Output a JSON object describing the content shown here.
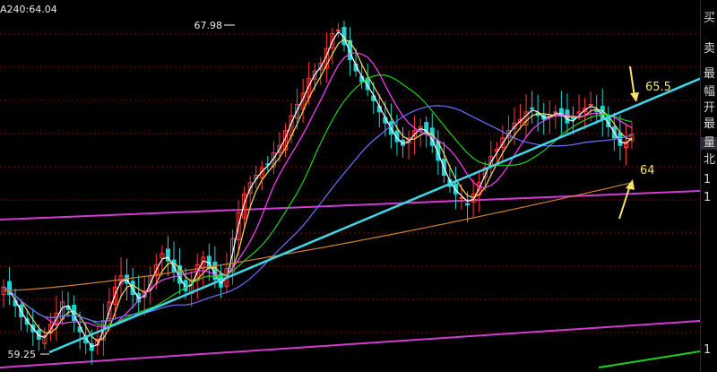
{
  "ma_label": "A240:64.04",
  "sidebar": {
    "items": [
      "买",
      "卖",
      "最",
      "幅",
      "开",
      "最",
      "量",
      "北",
      "1",
      "1",
      "1"
    ]
  },
  "colors": {
    "background": "#000000",
    "up_candle": "#ff3b3b",
    "down_candle": "#22d3d3",
    "grid": "#8b0000",
    "ma_fast": "#ffffff",
    "ma_5": "#f0e060",
    "ma_10": "#ff40ff",
    "ma_20": "#1fd01f",
    "ma_60": "#7070ff",
    "ma_240": "#d08030",
    "trendline": "#3fd7e8",
    "channel": "#d23cd2",
    "annotation": "#f4e46a"
  },
  "chart_data": {
    "type": "candlestick",
    "ylim": [
      59.25,
      67.98
    ],
    "high_label": "67.98",
    "low_label": "59.25",
    "closes": [
      61.0,
      60.8,
      60.5,
      60.2,
      60.0,
      59.8,
      59.6,
      59.7,
      60.0,
      60.3,
      60.6,
      60.4,
      60.1,
      59.8,
      59.5,
      59.3,
      59.6,
      60.1,
      60.6,
      61.0,
      61.3,
      61.1,
      60.8,
      60.6,
      60.9,
      61.3,
      61.6,
      61.9,
      61.7,
      61.4,
      61.1,
      60.9,
      61.2,
      61.6,
      61.8,
      61.5,
      61.2,
      61.0,
      61.5,
      62.3,
      63.0,
      63.5,
      63.8,
      64.0,
      64.2,
      64.3,
      64.6,
      64.8,
      65.2,
      65.6,
      65.9,
      66.2,
      66.6,
      66.8,
      67.0,
      67.4,
      67.8,
      67.9,
      67.5,
      67.1,
      66.8,
      66.5,
      66.3,
      66.0,
      65.7,
      65.4,
      65.1,
      64.9,
      64.8,
      65.0,
      65.2,
      65.3,
      65.1,
      64.8,
      64.4,
      64.0,
      63.7,
      63.5,
      63.4,
      63.2,
      63.5,
      63.8,
      64.2,
      64.5,
      64.7,
      65.0,
      65.2,
      65.4,
      65.5,
      65.7,
      65.8,
      65.6,
      65.5,
      65.6,
      65.7,
      65.6,
      65.4,
      65.5,
      65.7,
      65.8,
      65.9,
      65.7,
      65.5,
      65.3,
      65.0,
      64.8,
      64.9,
      65.1
    ],
    "annotations": [
      {
        "text": "65.5",
        "arrow": "down"
      },
      {
        "text": "64",
        "arrow": "up"
      }
    ],
    "series": [
      {
        "key": "ma_fast"
      },
      {
        "key": "ma_5"
      },
      {
        "key": "ma_10"
      },
      {
        "key": "ma_20"
      },
      {
        "key": "ma_60"
      },
      {
        "key": "ma_240"
      }
    ]
  }
}
